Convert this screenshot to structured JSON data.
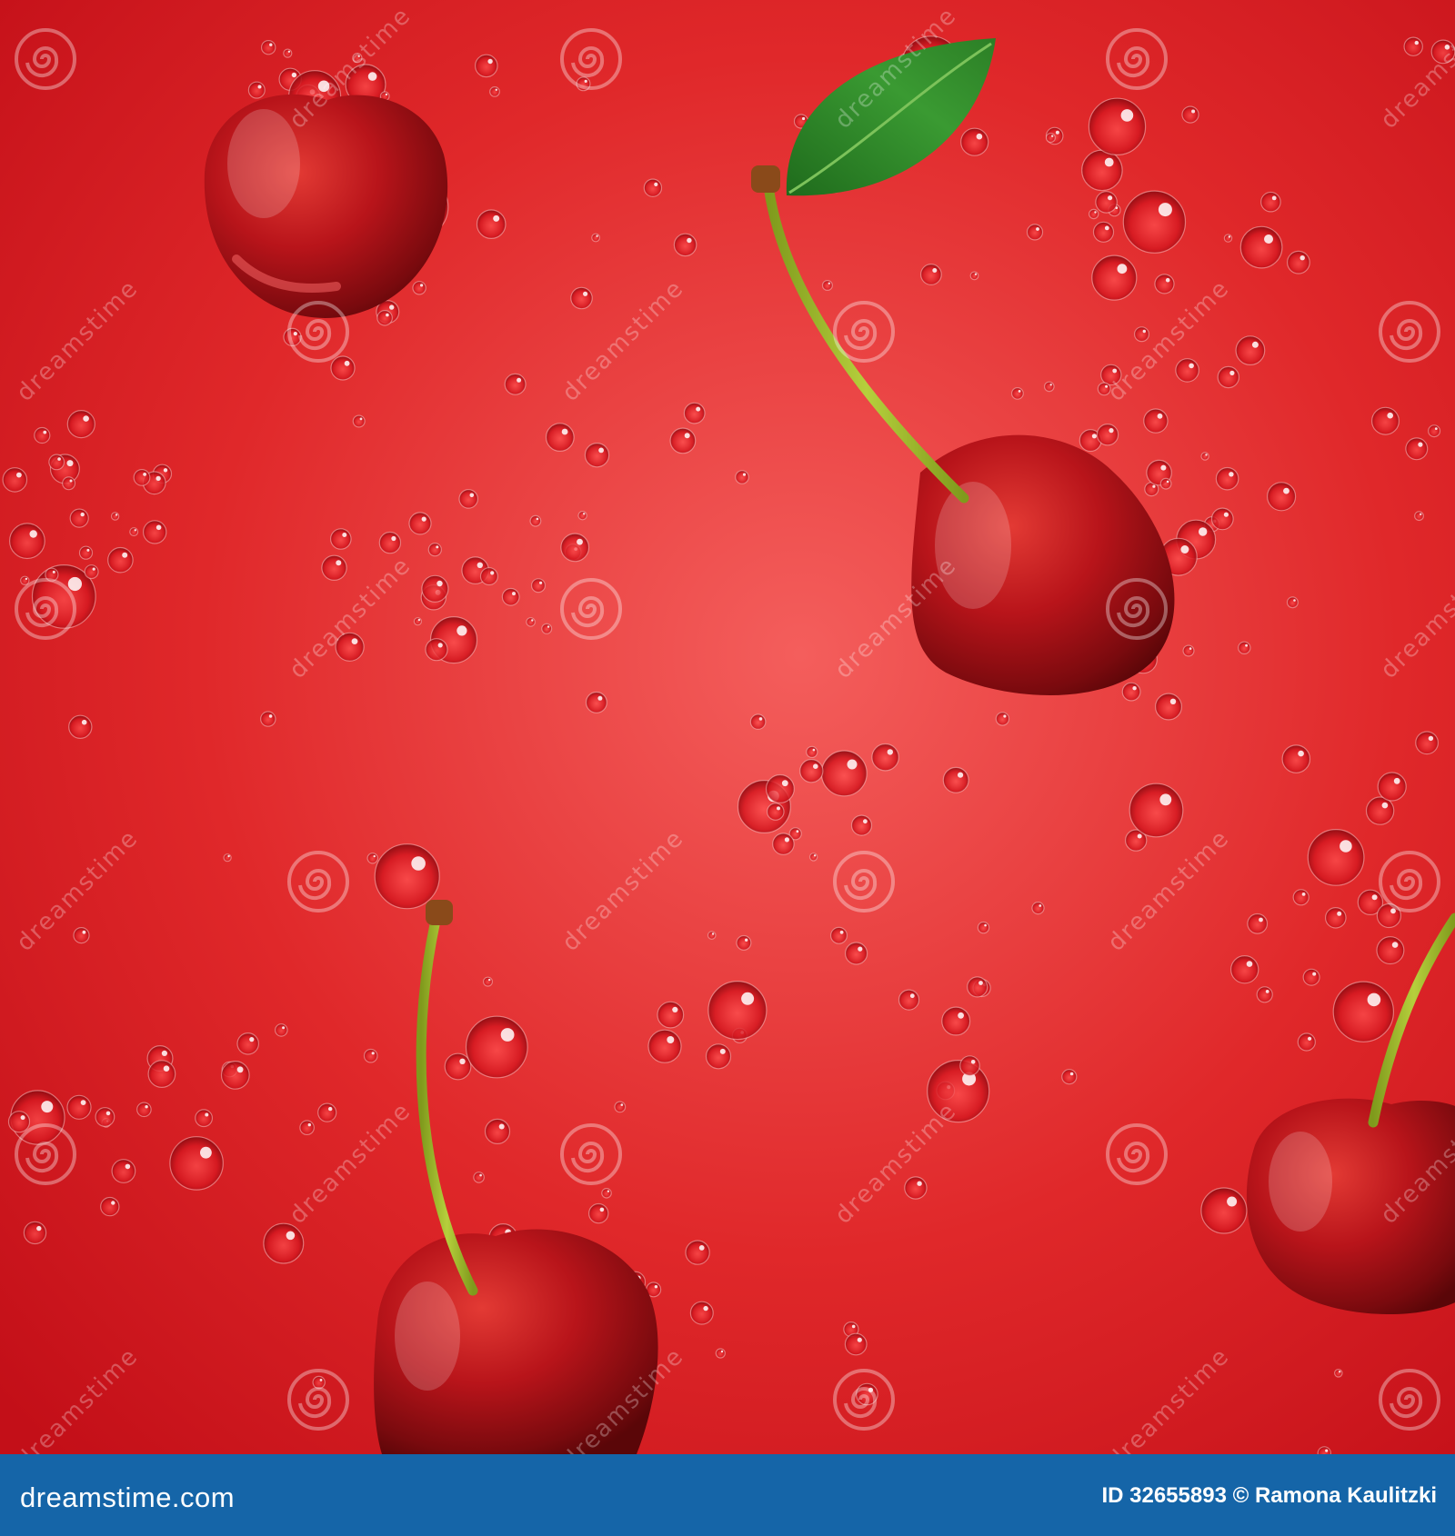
{
  "footer": {
    "site": "dreamstime.com",
    "id_label": "ID 32655893 ©",
    "author": "Ramona Kaulitzki"
  },
  "watermark": {
    "text": "dreamstime",
    "icon": "dreamstime-spiral-logo"
  },
  "colors": {
    "background_center": "#f45a5a",
    "background_edge": "#c8121a",
    "cherry": "#b01014",
    "stem": "#9dbb2a",
    "leaf": "#2f8a2a",
    "footer_bar": "#1565a8"
  },
  "cherries": [
    {
      "name": "cherry-top-left",
      "has_stem": false,
      "has_leaf": false
    },
    {
      "name": "cherry-with-leaf",
      "has_stem": true,
      "has_leaf": true
    },
    {
      "name": "cherry-bottom-center",
      "has_stem": true,
      "has_leaf": false
    },
    {
      "name": "cherry-bottom-right",
      "has_stem": true,
      "has_leaf": false
    }
  ]
}
